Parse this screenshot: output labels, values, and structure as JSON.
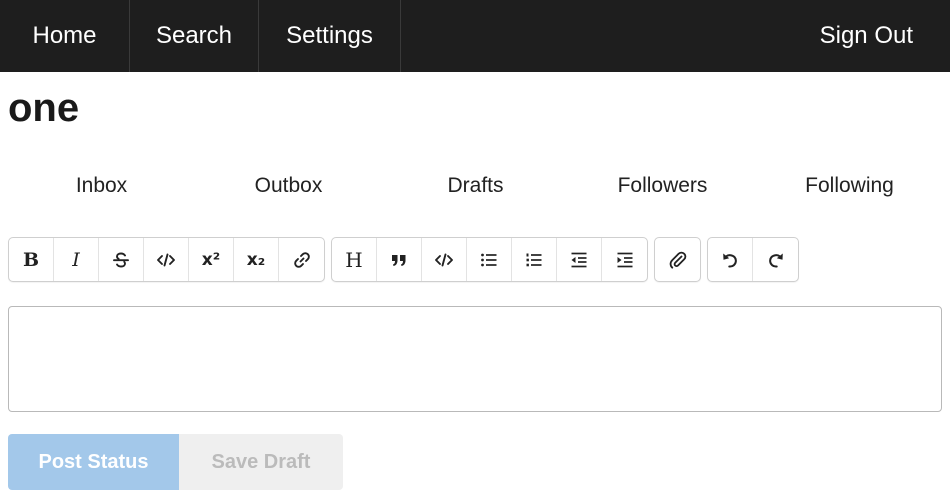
{
  "nav": {
    "home": "Home",
    "search": "Search",
    "settings": "Settings",
    "sign_out": "Sign Out"
  },
  "page": {
    "title": "one"
  },
  "tabs": [
    "Inbox",
    "Outbox",
    "Drafts",
    "Followers",
    "Following"
  ],
  "toolbar": {
    "bold": "B",
    "italic": "I",
    "heading": "H",
    "superscript": "x²",
    "subscript": "x₂",
    "icons": [
      "bold-icon",
      "italic-icon",
      "strikethrough-icon",
      "code-icon",
      "superscript-icon",
      "subscript-icon",
      "link-icon",
      "heading-icon",
      "quote-icon",
      "code-block-icon",
      "bullet-list-icon",
      "numbered-list-icon",
      "outdent-icon",
      "indent-icon",
      "attachment-icon",
      "undo-icon",
      "redo-icon"
    ]
  },
  "editor": {
    "value": ""
  },
  "actions": {
    "post_label": "Post Status",
    "draft_label": "Save Draft"
  },
  "colors": {
    "nav_bg": "#1e1e1e",
    "post_button": "#a3c8ea",
    "draft_button": "#efefef"
  }
}
